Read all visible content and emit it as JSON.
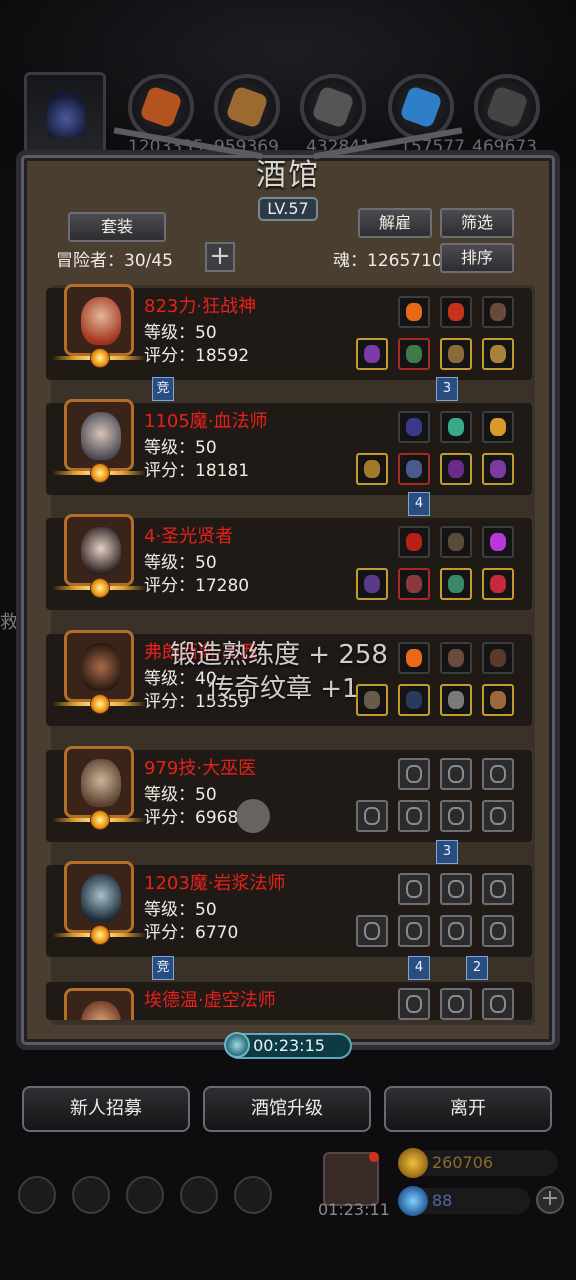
{
  "resources": [
    "1203335",
    "959369",
    "432841",
    "157577",
    "469673"
  ],
  "panel": {
    "title": "酒馆",
    "level": "LV.57",
    "outfit_btn": "套装",
    "dismiss_btn": "解雇",
    "filter_btn": "筛选",
    "sort_btn": "排序",
    "adventurer_count": "冒险者：30/45",
    "add_btn": "+",
    "soul": "魂：1265710"
  },
  "heroes": [
    {
      "name": "823力·狂战神",
      "level": "等级：50",
      "score": "评分：18592"
    },
    {
      "name": "1105魔·血法师",
      "level": "等级：50",
      "score": "评分：18181"
    },
    {
      "name": "4·圣光贤者",
      "level": "等级：50",
      "score": "评分：17280"
    },
    {
      "name": "弗朗西斯·杰西",
      "level": "等级：40",
      "score": "评分：15359"
    },
    {
      "name": "979技·大巫医",
      "level": "等级：50",
      "score": "评分：6968"
    },
    {
      "name": "1203魔·岩浆法师",
      "level": "等级：50",
      "score": "评分：6770"
    },
    {
      "name": "埃德温·虚空法师",
      "level": "",
      "score": ""
    }
  ],
  "tags": {
    "compete": "竞",
    "row1_slot": "3",
    "row2_slot": "4",
    "row5_slot": "3",
    "row6_slot_a": "4",
    "row6_slot_b": "2"
  },
  "floating": {
    "line1": "锻造熟练度 + 258",
    "line2": "传奇纹章 +1"
  },
  "timer": "00:23:15",
  "actions": {
    "recruit": "新人招募",
    "upgrade": "酒馆升级",
    "leave": "离开"
  },
  "gift_timer": "01:23:11",
  "currency": {
    "gold": "260706",
    "gems": "88"
  },
  "side_text": "救",
  "colors": {
    "hero_name": "#e8201c",
    "accent_gold": "#c49b2f",
    "timer": "#0e3a44"
  }
}
